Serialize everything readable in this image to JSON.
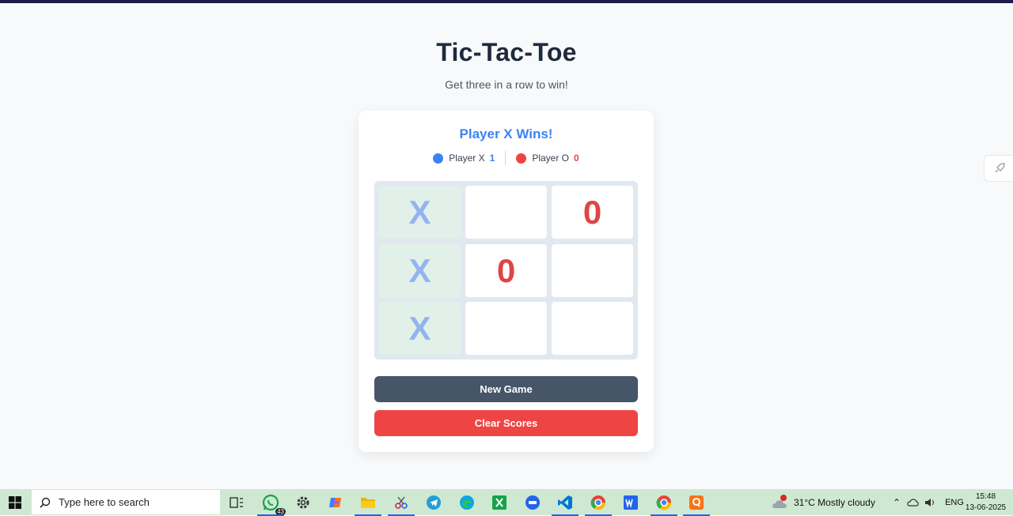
{
  "header": {
    "title": "Tic-Tac-Toe",
    "subtitle": "Get three in a row to win!"
  },
  "game": {
    "status": "Player X Wins!",
    "scores": {
      "x_label": "Player X",
      "x_value": "1",
      "o_label": "Player O",
      "o_value": "0"
    },
    "board": [
      "X",
      "",
      "0",
      "X",
      "0",
      "",
      "X",
      "",
      ""
    ],
    "winning_cells": [
      0,
      3,
      6
    ],
    "buttons": {
      "new_game": "New Game",
      "clear_scores": "Clear Scores"
    }
  },
  "colors": {
    "player_x": "#3b82f6",
    "player_o": "#ef4444",
    "win_cell": "#e2f0ea"
  },
  "taskbar": {
    "search_placeholder": "Type here to search",
    "whatsapp_badge": "43",
    "weather": "31°C  Mostly cloudy",
    "language": "ENG",
    "time": "15:48",
    "date": "13-06-2025",
    "apps": [
      "task-view-icon",
      "whatsapp-icon",
      "settings-icon",
      "copilot-icon",
      "file-explorer-icon",
      "snipping-tool-icon",
      "telegram-icon",
      "edge-icon",
      "excel-icon",
      "zoom-icon",
      "vscode-icon",
      "chrome-icon",
      "word-icon",
      "chrome-icon",
      "qbittorrent-icon"
    ]
  }
}
